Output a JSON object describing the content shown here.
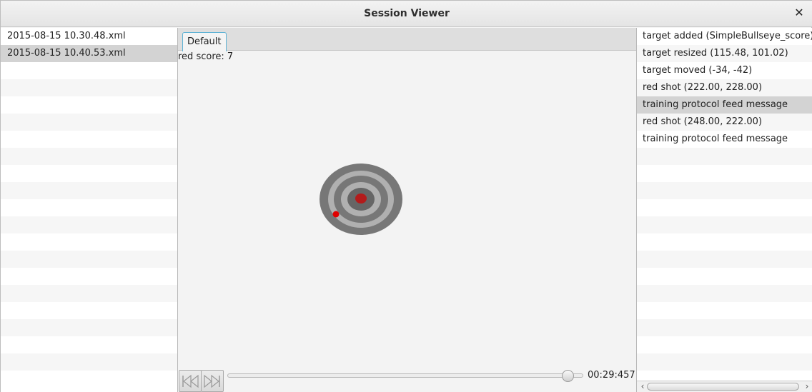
{
  "window": {
    "title": "Session Viewer",
    "close_glyph": "✕"
  },
  "sessions": {
    "items": [
      {
        "label": "2015-08-15 10.30.48.xml",
        "selected": false
      },
      {
        "label": "2015-08-15 10.40.53.xml",
        "selected": true
      }
    ]
  },
  "center": {
    "tab_label": "Default",
    "score_text": "red score: 7",
    "time_text": "00:29:457",
    "playback_progress": 0.97,
    "rewind_icon": "skip-to-start-icon",
    "forward_icon": "skip-to-end-icon"
  },
  "events": {
    "items": [
      {
        "label": "target added (SimpleBullseye_score)",
        "selected": false
      },
      {
        "label": "target resized (115.48, 101.02)",
        "selected": false
      },
      {
        "label": "target moved (-34, -42)",
        "selected": false
      },
      {
        "label": "red shot (222.00, 228.00)",
        "selected": false
      },
      {
        "label": "training protocol feed message",
        "selected": true
      },
      {
        "label": "red shot (248.00, 222.00)",
        "selected": false
      },
      {
        "label": "training protocol feed message",
        "selected": false
      }
    ]
  },
  "colors": {
    "accent": "#5fb2d4",
    "shot": "#e00000",
    "target_center": "#b31b1b"
  }
}
